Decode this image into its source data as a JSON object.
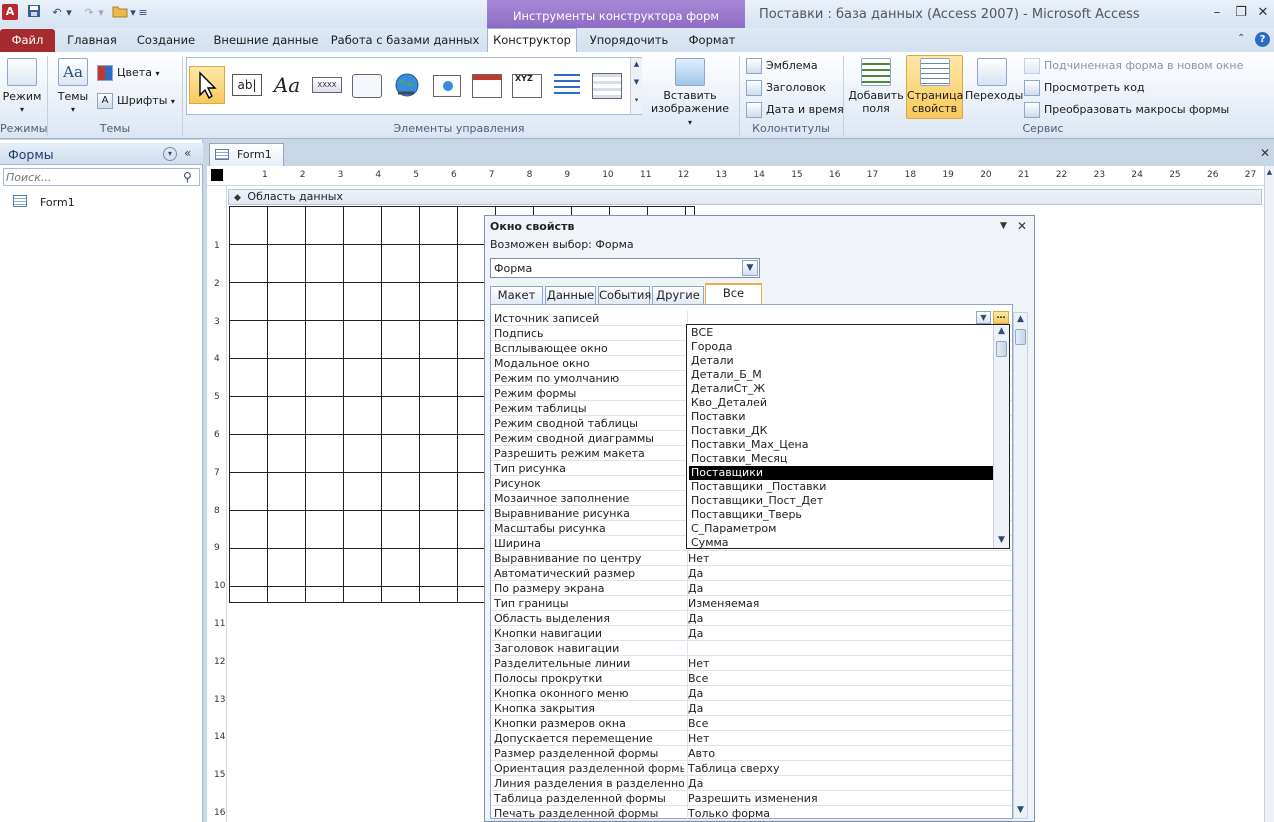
{
  "window": {
    "title": "Поставки : база данных (Access 2007)  -  Microsoft Access",
    "context_tab": "Инструменты конструктора форм",
    "controls": {
      "minimize": "–",
      "restore": "❐",
      "close": "✕"
    }
  },
  "app_icon_letter": "A",
  "ribbon_tabs": [
    "Файл",
    "Главная",
    "Создание",
    "Внешние данные",
    "Работа с базами данных",
    "Конструктор",
    "Упорядочить",
    "Формат"
  ],
  "ribbon": {
    "groups": {
      "modes": "Режимы",
      "themes": "Темы",
      "controls": "Элементы управления",
      "header_footer": "Колонтитулы",
      "tools": "Сервис"
    },
    "mode_btn": "Режим",
    "themes_btn": "Темы",
    "colors_btn": "Цвета",
    "fonts_btn": "Шрифты",
    "gallery": {
      "label_icon": "ab|",
      "text_icon": "Aa",
      "xxxx_icon": "XXXX",
      "xyz_icon": "XYZ"
    },
    "insert_image": [
      "Вставить",
      "изображение"
    ],
    "emblem": "Эмблема",
    "header": "Заголовок",
    "datetime": "Дата и время",
    "add_fields": [
      "Добавить",
      "поля"
    ],
    "prop_sheet": [
      "Страница",
      "свойств"
    ],
    "transitions": "Переходы",
    "subform_new_window": "Подчиненная форма в новом окне",
    "view_code": "Просмотреть код",
    "convert_macros": "Преобразовать макросы формы"
  },
  "nav": {
    "title": "Формы",
    "search_placeholder": "Поиск...",
    "items": [
      "Form1"
    ]
  },
  "document": {
    "tab": "Form1",
    "section": "Область данных",
    "ruler_h": [
      "1",
      "2",
      "3",
      "4",
      "5",
      "6",
      "7",
      "8",
      "9",
      "10",
      "11",
      "12",
      "13",
      "14",
      "15",
      "16",
      "17",
      "18",
      "19",
      "20",
      "21",
      "22",
      "23",
      "24",
      "25",
      "26",
      "27"
    ],
    "ruler_v": [
      "1",
      "2",
      "3",
      "4",
      "5",
      "6",
      "7",
      "8",
      "9",
      "10",
      "11",
      "12",
      "13",
      "14",
      "15",
      "16"
    ]
  },
  "property_sheet": {
    "title": "Окно свойств",
    "selection_label": "Возможен выбор:  Форма",
    "object": "Форма",
    "tabs": [
      "Макет",
      "Данные",
      "События",
      "Другие",
      "Все"
    ],
    "active_tab": "Все",
    "rows": [
      {
        "name": "Источник записей",
        "value": ""
      },
      {
        "name": "Подпись",
        "value": ""
      },
      {
        "name": "Всплывающее окно",
        "value": ""
      },
      {
        "name": "Модальное окно",
        "value": ""
      },
      {
        "name": "Режим по умолчанию",
        "value": ""
      },
      {
        "name": "Режим формы",
        "value": ""
      },
      {
        "name": "Режим таблицы",
        "value": ""
      },
      {
        "name": "Режим сводной таблицы",
        "value": ""
      },
      {
        "name": "Режим сводной диаграммы",
        "value": ""
      },
      {
        "name": "Разрешить режим макета",
        "value": ""
      },
      {
        "name": "Тип рисунка",
        "value": ""
      },
      {
        "name": "Рисунок",
        "value": ""
      },
      {
        "name": "Мозаичное заполнение",
        "value": ""
      },
      {
        "name": "Выравнивание рисунка",
        "value": ""
      },
      {
        "name": "Масштабы рисунка",
        "value": ""
      },
      {
        "name": "Ширина",
        "value": ""
      },
      {
        "name": "Выравнивание по центру",
        "value": "Нет"
      },
      {
        "name": "Автоматический размер",
        "value": "Да"
      },
      {
        "name": "По размеру экрана",
        "value": "Да"
      },
      {
        "name": "Тип границы",
        "value": "Изменяемая"
      },
      {
        "name": "Область выделения",
        "value": "Да"
      },
      {
        "name": "Кнопки навигации",
        "value": "Да"
      },
      {
        "name": "Заголовок навигации",
        "value": ""
      },
      {
        "name": "Разделительные линии",
        "value": "Нет"
      },
      {
        "name": "Полосы прокрутки",
        "value": "Все"
      },
      {
        "name": "Кнопка оконного меню",
        "value": "Да"
      },
      {
        "name": "Кнопка закрытия",
        "value": "Да"
      },
      {
        "name": "Кнопки размеров окна",
        "value": "Все"
      },
      {
        "name": "Допускается перемещение",
        "value": "Нет"
      },
      {
        "name": "Размер разделенной формы",
        "value": "Авто"
      },
      {
        "name": "Ориентация разделенной формы",
        "value": "Таблица сверху"
      },
      {
        "name": "Линия разделения в разделенной форме",
        "value": "Да"
      },
      {
        "name": "Таблица разделенной формы",
        "value": "Разрешить изменения"
      },
      {
        "name": "Печать разделенной формы",
        "value": "Только форма"
      }
    ],
    "dropdown": {
      "items": [
        "ВСЕ",
        "Города",
        "Детали",
        "Детали_Б_М",
        "ДеталиСт_Ж",
        "Кво_Деталей",
        "Поставки",
        "Поставки_ДК",
        "Поставки_Max_Цена",
        "Поставки_Месяц",
        "Поставщики",
        "Поставщики _Поставки",
        "Поставщики_Пост_Дет",
        "Поставщики_Тверь",
        "С_Параметром",
        "Сумма"
      ],
      "selected": "Поставщики"
    },
    "build_btn": "…"
  }
}
